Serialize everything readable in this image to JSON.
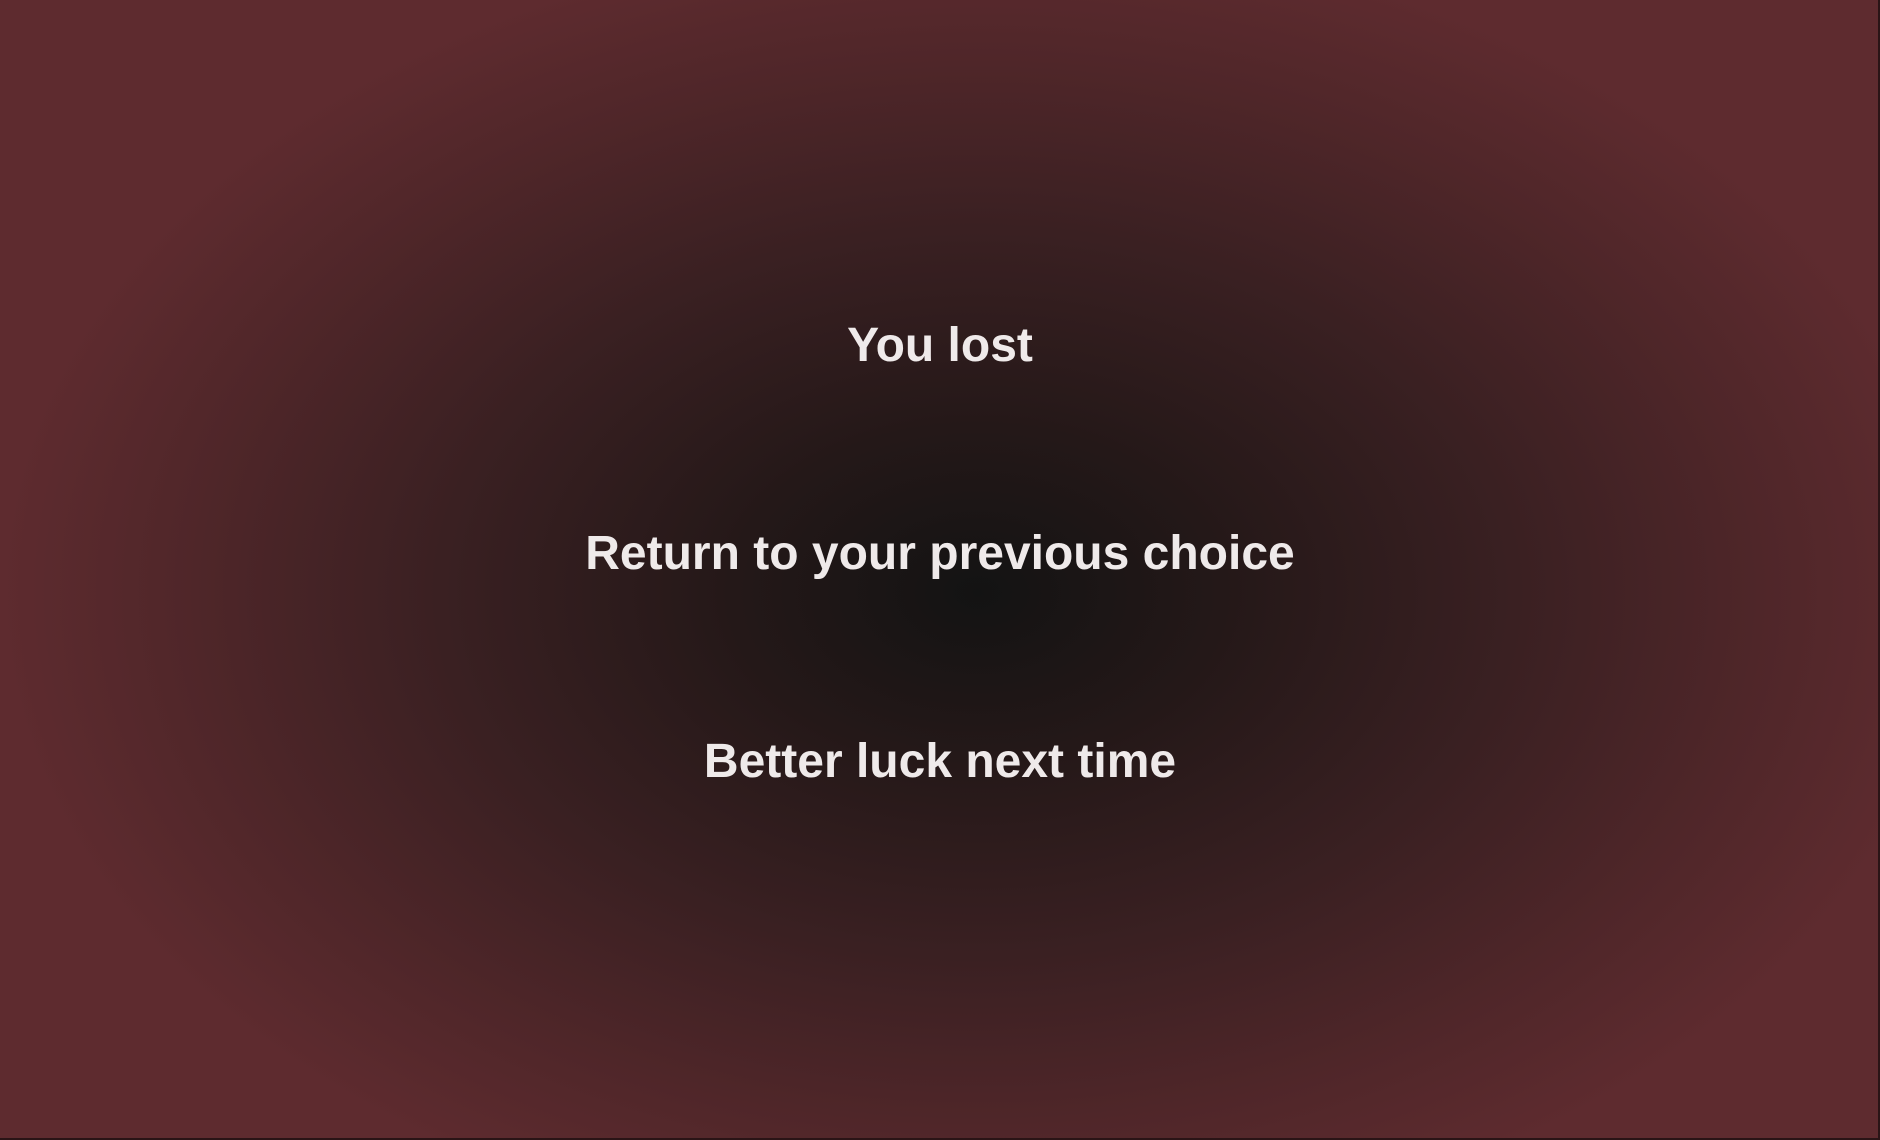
{
  "game_over": {
    "title": "You lost",
    "options": [
      {
        "label": "Return to your previous choice"
      },
      {
        "label": "Better luck next time"
      }
    ]
  },
  "colors": {
    "background_edge": "#5e2b2f",
    "background_center": "#131313",
    "text": "#efeaea"
  }
}
